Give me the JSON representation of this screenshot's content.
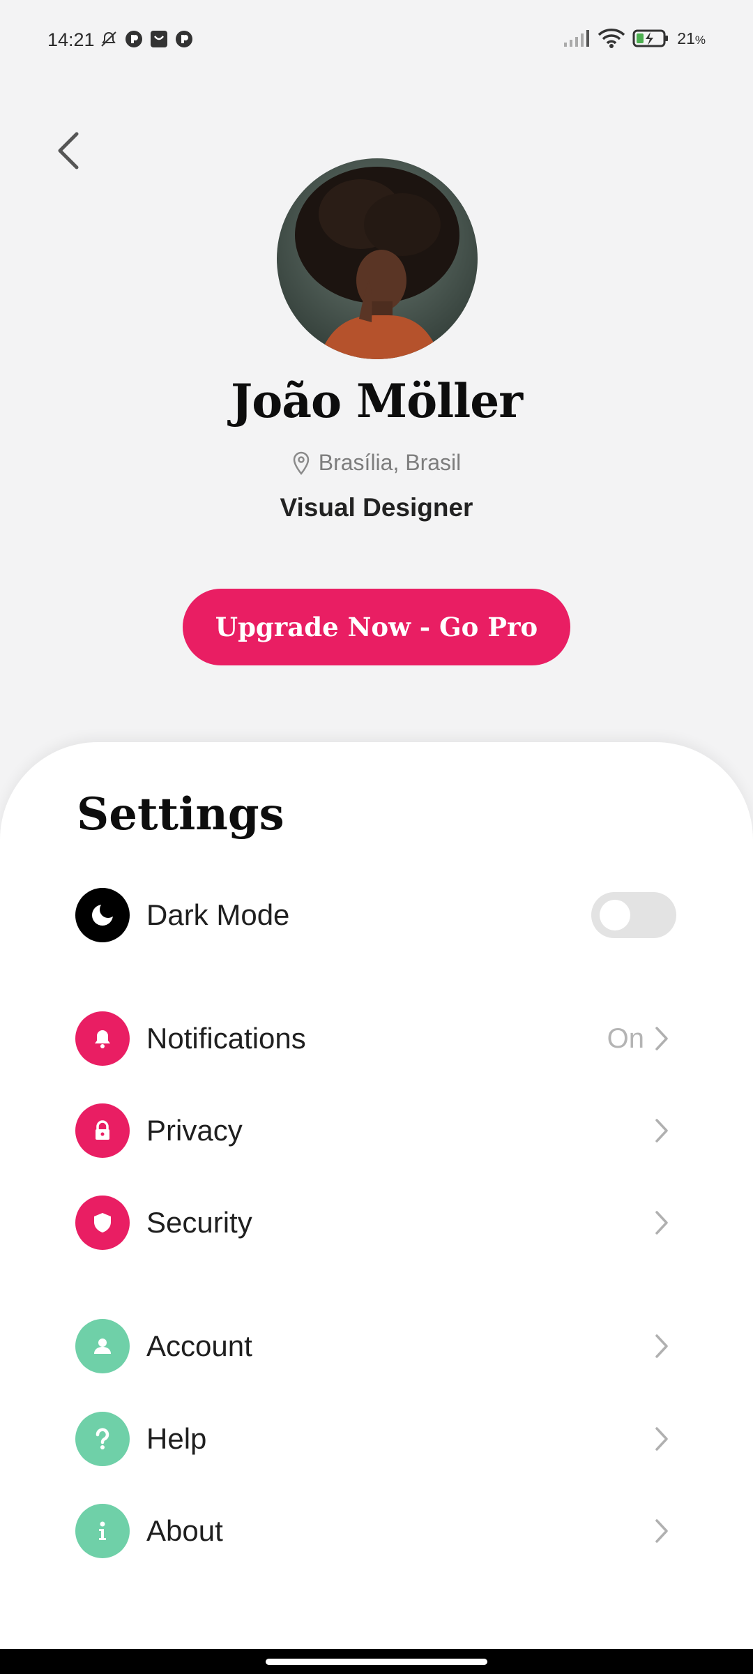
{
  "status_bar": {
    "time": "14:21",
    "battery_percent": "21",
    "battery_unit": "%",
    "icons": [
      "mute-alarm-icon",
      "app-icon",
      "shopping-icon",
      "app-icon",
      "signal-icon",
      "wifi-icon",
      "battery-charging-icon"
    ]
  },
  "profile": {
    "name": "João Möller",
    "location": "Brasília, Brasil",
    "title": "Visual Designer",
    "avatar": "avatar-photo"
  },
  "upgrade_button": {
    "label": "Upgrade Now - Go Pro"
  },
  "settings": {
    "title": "Settings",
    "items": [
      {
        "label": "Dark Mode",
        "icon": "moon-icon",
        "type": "toggle",
        "checked": false
      },
      {
        "label": "Notifications",
        "icon": "bell-icon",
        "type": "link",
        "value": "On"
      },
      {
        "label": "Privacy",
        "icon": "lock-icon",
        "type": "link"
      },
      {
        "label": "Security",
        "icon": "shield-icon",
        "type": "link"
      },
      {
        "label": "Account",
        "icon": "user-icon",
        "type": "link"
      },
      {
        "label": "Help",
        "icon": "question-icon",
        "type": "link"
      },
      {
        "label": "About",
        "icon": "info-icon",
        "type": "link"
      }
    ]
  },
  "colors": {
    "accent": "#e91e63",
    "secondary": "#6fd0a8",
    "background": "#f3f3f4",
    "sheet": "#ffffff"
  }
}
